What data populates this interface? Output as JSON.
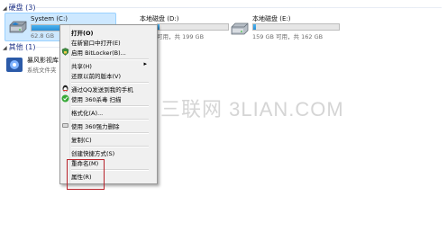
{
  "sections": {
    "hard_disks": "硬盘 (3)",
    "other": "其他 (1)"
  },
  "drives": [
    {
      "name": "System (C:)",
      "free_text": "62.8 GB",
      "usage": 0.62,
      "bar_color": "#2a8ed6"
    },
    {
      "name": "本地磁盘 (D:)",
      "free_text": "可用，共 199 GB",
      "usage": 0.02,
      "bar_color": "#2a8ed6"
    },
    {
      "name": "本地磁盘 (E:)",
      "free_text": "159 GB 可用，共 162 GB",
      "usage": 0.03,
      "bar_color": "#2a8ed6"
    }
  ],
  "other_items": [
    {
      "name": "暴风影视库",
      "sub": "系统文件夹"
    }
  ],
  "context_menu": {
    "items": [
      {
        "label": "打开(O)",
        "bold": true,
        "icon": "none"
      },
      {
        "label": "在新窗口中打开(E)",
        "icon": "none"
      },
      {
        "label": "启用 BitLocker(B)...",
        "icon": "bitlocker-shield-icon"
      },
      {
        "label": "共享(H)",
        "icon": "none",
        "submenu": true
      },
      {
        "label": "还原以前的版本(V)",
        "icon": "none"
      },
      {
        "label": "通过QQ发送到我的手机",
        "icon": "qq-penguin-icon"
      },
      {
        "label": "使用 360杀毒 扫描",
        "icon": "360-antivirus-icon"
      },
      {
        "label": "格式化(A)...",
        "icon": "none"
      },
      {
        "label": "使用 360强力删除",
        "icon": "360-delete-icon"
      },
      {
        "label": "复制(C)",
        "icon": "none"
      },
      {
        "label": "创建快捷方式(S)",
        "icon": "none"
      },
      {
        "label": "重命名(M)",
        "icon": "none"
      },
      {
        "label": "属性(R)",
        "icon": "none"
      }
    ]
  },
  "watermark": "三联网 3LIAN.COM",
  "colors": {
    "selection_fill": "#cde8ff",
    "selection_border": "#99d1ff",
    "menu_bg": "#f0f0f0",
    "highlight_red": "#b8222a",
    "section_title": "#1e3287"
  }
}
